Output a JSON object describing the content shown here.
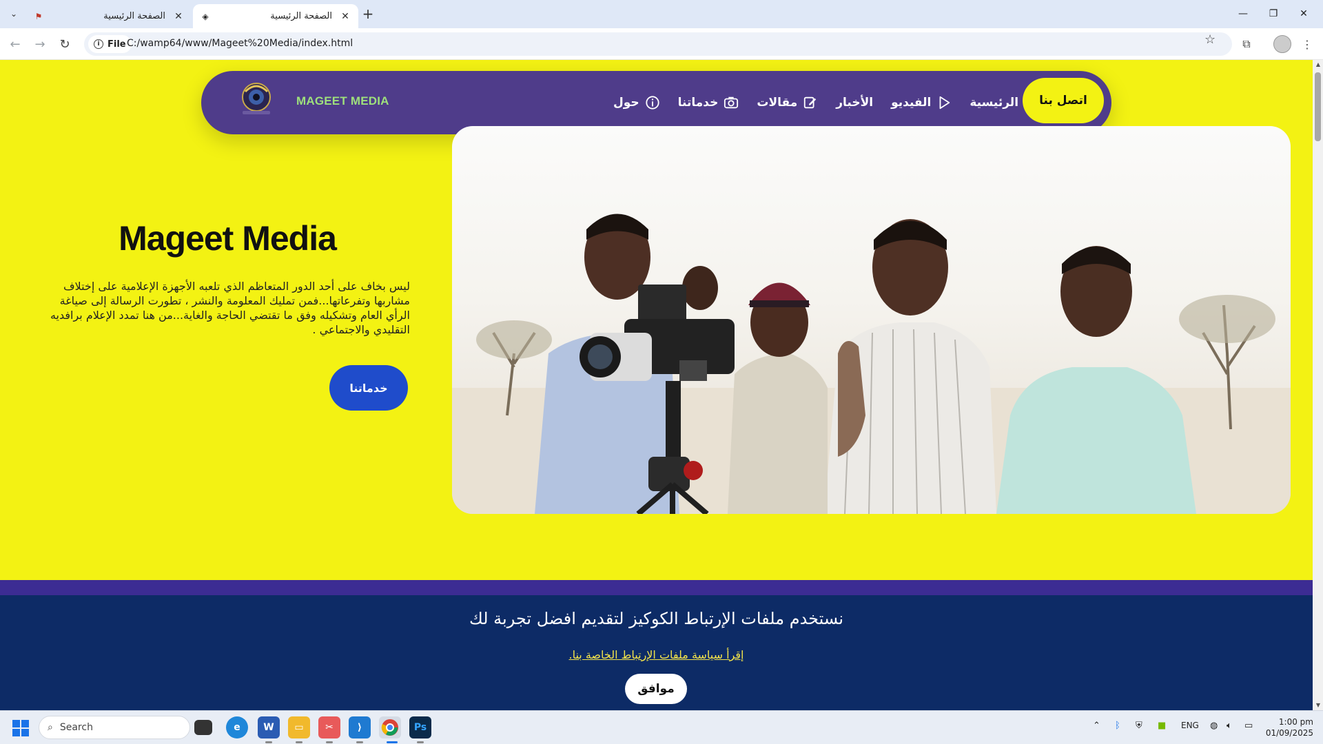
{
  "browser": {
    "tabs": [
      {
        "title": "الصفحة الرئيسية",
        "active": false
      },
      {
        "title": "الصفحة الرئيسية",
        "active": true
      }
    ],
    "site_chip": "File",
    "url": "C:/wamp64/www/Mageet%20Media/index.html"
  },
  "nav": {
    "brand": "MAGEET MEDIA",
    "items": [
      {
        "label": "الرئيسية",
        "icon": "graduation-cap-icon"
      },
      {
        "label": "الفيديو",
        "icon": "play-icon"
      },
      {
        "label": "الأخبار",
        "icon": ""
      },
      {
        "label": "مقالات",
        "icon": "edit-icon"
      },
      {
        "label": "خدماتنا",
        "icon": "camera-icon"
      },
      {
        "label": "حول",
        "icon": "info-icon"
      }
    ],
    "contact": "اتصل بنا"
  },
  "hero": {
    "title": "Mageet Media",
    "text": "ليس بخاف على أحد الدور المتعاظم الذي تلعبه الأجهزة الإعلامية على إختلاف مشاربها وتفرعاتها...فمن تمليك المعلومة والنشر ، تطورت الرسالة إلى صياغة الرأي العام وتشكيله وفق ما تقتضي الحاجة والغاية...من هنا تمدد الإعلام برافديه التقليدي والاجتماعي .",
    "button": "خدماتنا"
  },
  "cookie": {
    "message": "نستخدم ملفات الإرتباط الكوكيز لتقديم افضل تجربة لك",
    "link": "إقرأ سياسة ملفات الإرتباط الخاصة بنا.",
    "button": "موافق"
  },
  "taskbar": {
    "search_placeholder": "Search",
    "lang": "ENG",
    "time": "1:00 pm",
    "date": "01/09/2025"
  },
  "colors": {
    "page_bg": "#f3f213",
    "nav_bg": "#4f3c8a",
    "brand": "#9ee07c",
    "hero_button": "#1f4ccb",
    "cookie_bg": "#0d2b66",
    "cookie_link": "#f3e34a"
  }
}
